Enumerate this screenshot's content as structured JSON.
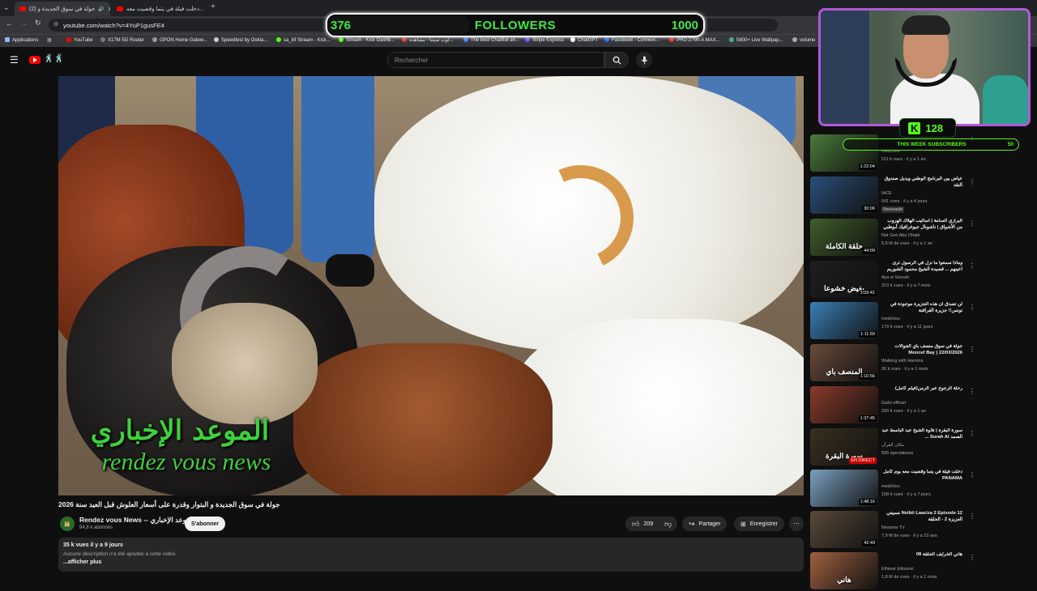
{
  "browser": {
    "tabs": [
      {
        "label": "(2) جولة في سوق الجديدة و ",
        "active": true
      },
      {
        "label": "دخلت فيلة في يتما وقضيت معه...",
        "active": false
      }
    ],
    "url": "youtube.com/watch?v=4YuP1gusFE4",
    "bookmarks": [
      "Applications",
      "YouTube",
      "X17M 5G Router",
      "GPON Home Gatew...",
      "Speedtest by Ookla...",
      "sa_iiif Stream - Kick...",
      "Stream - Kick Dashb...",
      "لوب سيتنا - مشاهدة...",
      "The best ChatBot an...",
      "Stripe Express",
      "ChatGPT",
      "Facebook - Connexi...",
      "PRO Z790-A MAX...",
      "5800+ Live Wallpap...",
      "volume"
    ]
  },
  "youtube": {
    "search_placeholder": "Rechercher",
    "logo_emoji": "🕺🏽🕺🏽"
  },
  "video": {
    "watermark_ar": "الموعد الإخباري",
    "watermark_fr": "rendez vous news",
    "title": "جولة في سوق الجديدة و البتوار وقدرة على أسعار العلوش قبل العيد سنة 2026",
    "channel": "Rendez vous News -- الموعد الإخباري",
    "subscribers": "94,8 k abonnés",
    "subscribe": "S'abonner",
    "likes": "209",
    "share": "Partager",
    "save": "Enregistrer",
    "views_age": "35 k vues  il y a 9 jours",
    "description": "Aucune description n'a été ajoutée à cette vidéo.",
    "more": "...afficher plus"
  },
  "overlay": {
    "followers_current": "376",
    "followers_label": "FOLLOWERS",
    "followers_goal": "1000",
    "followers_progress": 0.376,
    "kick_count": "128",
    "week_label": "THIS WEEK SUBSCRIBERS",
    "week_count": "50"
  },
  "sidebar": [
    {
      "title": "",
      "channel": "medchou",
      "views": "511 k vues · il y a 1 an",
      "duration": "1:22:04",
      "color": "#4a7a3a"
    },
    {
      "title": "عياض بين البرنامج الوطني وبديل صندوق النقد",
      "channel": "IACE",
      "views": "541 vues · il y a 4 jours",
      "badge": "Nouveauté",
      "duration": "30:06",
      "color": "#2a4f7a"
    },
    {
      "title": "البراري السامة | أساليب الهلاك الهروب من الأشواق | ناشونال جيوغرافيك أبوظبي",
      "channel": "Nat Geo Abu Dhabi",
      "views": "5,6 M de vues · il y a 1 an",
      "duration": "44:09",
      "color": "#3f5d2a",
      "thumb_text": "حلقة الكاملة"
    },
    {
      "title": "وماذا سمعوا ما نزل في الرسول ترى اعينهم ... قصيدة الشيخ محمود الشوريم",
      "channel": "Aya w Sourah",
      "views": "313 k vues · il y a 7 mois",
      "duration": "3:09:41",
      "color": "#1e1e1e",
      "thumb_text": "يفيض خشوعا"
    },
    {
      "title": "لن تصدق أن هذه الجزيرة موجودة في تونس!! جزيرة القراقنة",
      "channel": "medchou",
      "views": "179 k vues · il y a 11 jours",
      "duration": "1:11:59",
      "color": "#3a7fb5"
    },
    {
      "title": "جولة في سوق منصف باي الجوالات Moncef Bay ) 22/03/2026",
      "channel": "Walking with Hamma",
      "views": "30 k vues · il y a 1 mois",
      "duration": "1:10:56",
      "color": "#6a4a3a",
      "thumb_text": "المنصف باي"
    },
    {
      "title": "رحلة الرجوع عبر الزمن(فيلم كامل)",
      "channel": "Gafsi officiel",
      "views": "290 k vues · il y a 1 an",
      "duration": "1:37:45",
      "color": "#8a3a2a"
    },
    {
      "title": "سورة البقرة | تلاوة الشيخ عبد الباسط عبد الصمد Surah Al ...",
      "channel": "مكان القرآن",
      "views": "505 spectateurs",
      "live": "EN DIRECT",
      "color": "#3a3020",
      "thumb_text": "سورة البقرة"
    },
    {
      "title": "دخلت فيلة في يتما وقضيت معه يوم كامل PANAMA",
      "channel": "medchou",
      "views": "158 k vues · il y a 7 jours",
      "duration": "1:48:16",
      "color": "#7aa0c0"
    },
    {
      "title": "Nsibti Laaziza 2 Episode 12 نسيبتي العزيزة 2 - الحلقة",
      "channel": "Nessma TV",
      "views": "7,9 M de vues · il y a 10 ans",
      "duration": "42:49",
      "color": "#5a4a3a"
    },
    {
      "title": "هاني الخرايف الحلقة 08",
      "channel": "Elhiwar Ettounsi",
      "views": "1,8 M de vues · il y a 1 mois",
      "duration": "",
      "color": "#a06040",
      "thumb_text": "هاني"
    }
  ],
  "colors": {
    "yt_red": "#ff0000",
    "follower_green": "#3de843",
    "kick_green": "#53fc18",
    "webcam_border": "#b05ad8"
  }
}
